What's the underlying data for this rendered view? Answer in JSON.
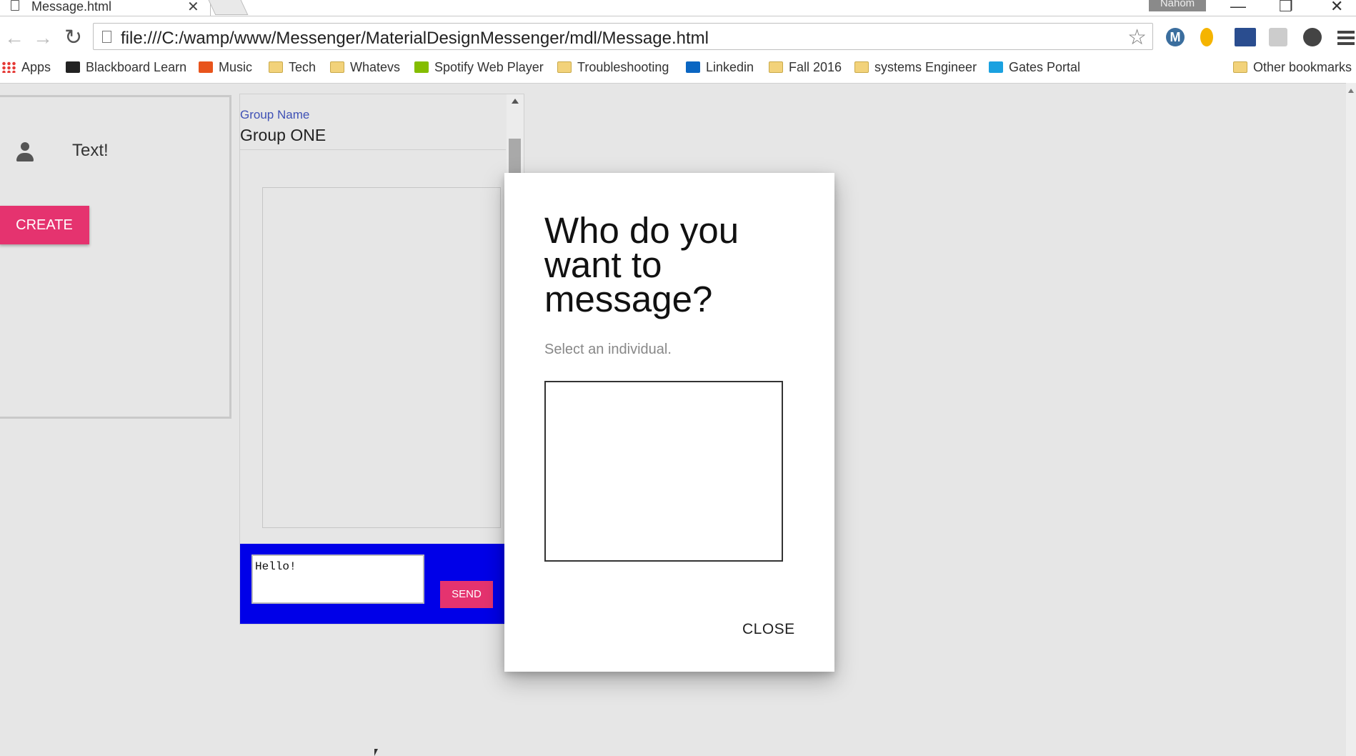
{
  "browser": {
    "tab_title": "Message.html",
    "tab_close": "✕",
    "profile_name": "Nahom",
    "url": "file:///C:/wamp/www/Messenger/MaterialDesignMessenger/mdl/Message.html",
    "window_controls": [
      "—",
      "❐",
      "✕"
    ]
  },
  "bookmarks": [
    {
      "label": "Apps",
      "icon": "apps-grid-icon"
    },
    {
      "label": "Blackboard Learn",
      "icon": "blackboard-icon"
    },
    {
      "label": "Music",
      "icon": "music-icon"
    },
    {
      "label": "Tech",
      "icon": "folder-icon"
    },
    {
      "label": "Whatevs",
      "icon": "folder-icon"
    },
    {
      "label": "Spotify Web Player",
      "icon": "spotify-icon"
    },
    {
      "label": "Troubleshooting",
      "icon": "folder-icon"
    },
    {
      "label": "Linkedin",
      "icon": "linkedin-icon"
    },
    {
      "label": "Fall 2016",
      "icon": "folder-icon"
    },
    {
      "label": "systems Engineer",
      "icon": "folder-icon"
    },
    {
      "label": "Gates Portal",
      "icon": "cloud-icon"
    },
    {
      "label": "Other bookmarks",
      "icon": "folder-icon"
    }
  ],
  "left_panel": {
    "contact_text": "Text!",
    "create_label": "CREATE"
  },
  "chat": {
    "group_label": "Group Name",
    "group_name": "Group ONE",
    "compose_value": "Hello!",
    "send_label": "SEND"
  },
  "dialog": {
    "title": "Who do you want to message?",
    "subtitle": "Select an individual.",
    "close_label": "CLOSE"
  },
  "colors": {
    "accent_pink": "#e5336f",
    "compose_blue": "#0000e8",
    "label_indigo": "#3f51b5"
  }
}
